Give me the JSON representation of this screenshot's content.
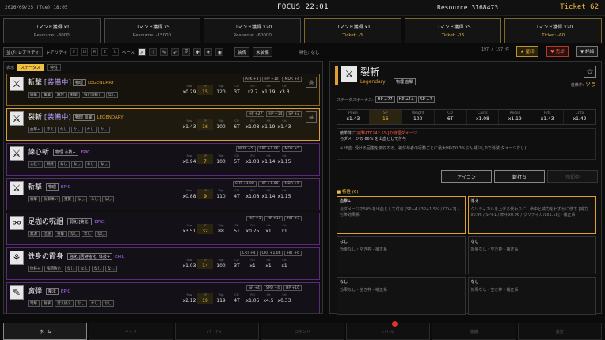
{
  "topbar": {
    "datetime": "2026/09/25 (Tue) 18:05",
    "focus": "FOCUS 22:01",
    "resource": "Resource 3168473",
    "ticket": "Ticket 62"
  },
  "commands": [
    {
      "title": "コマンド獲得 x1",
      "cost": "Resource: -3000"
    },
    {
      "title": "コマンド獲得 x5",
      "cost": "Resource: -15000"
    },
    {
      "title": "コマンド獲得 x20",
      "cost": "Resource: -60000"
    },
    {
      "title": "コマンド獲得 x1",
      "cost": "Ticket: -3"
    },
    {
      "title": "コマンド獲得 x5",
      "cost": "Ticket: -15"
    },
    {
      "title": "コマンド獲得 x20",
      "cost": "Ticket: -60"
    }
  ],
  "filter": {
    "rarity_btn": "並び: レアリティ",
    "rarity_label": "レアリティ",
    "letters": [
      "C",
      "U",
      "R",
      "E",
      "L"
    ],
    "base_label": "ベース",
    "owned": "装備",
    "unequip": "未装備",
    "trait_label": "特性: なし",
    "count": "197 / 197\n件",
    "fav": "★ 星印",
    "kyu": "♥ 売却",
    "sort": "▼ 詳細"
  },
  "list": {
    "show": "表示",
    "tab1": "ステータス",
    "tab2": "特性",
    "items": [
      {
        "name": "斬撃",
        "equip": "[装備中]",
        "tag": "物理",
        "rar": "LEGENDARY",
        "rcls": "legendary",
        "cls": "leg",
        "icon": "⚔",
        "traits": [
          "痛撃",
          "撃撃",
          "麻合",
          "軽量",
          "強い溶斬し",
          "なし"
        ],
        "bonus": [
          "ATK +3",
          "HP +10",
          "MDR +4"
        ],
        "stats": [
          "x0.29",
          "15",
          "120",
          "3T",
          "x2.7",
          "x1.19",
          "x3.3"
        ],
        "mark": "☠"
      },
      {
        "name": "裂斬",
        "equip": "[装備中]",
        "tag": "物理 血擊",
        "rar": "LEGENDARY",
        "rcls": "legendary",
        "cls": "sel",
        "icon": "⚔",
        "traits": [
          "血撃+",
          "浮え",
          "なし",
          "なし",
          "なし",
          "なし"
        ],
        "bonus": [
          "HP +27",
          "HP +14",
          "SP +2"
        ],
        "stats": [
          "x1.43",
          "16",
          "100",
          "6T",
          "x1.08",
          "x1.19",
          "x1.43"
        ],
        "mark": "☠"
      },
      {
        "name": "練心斬",
        "equip": "",
        "tag": "物理 心技+",
        "rar": "EPIC",
        "rcls": "epic",
        "cls": "",
        "icon": "⚔",
        "traits": [
          "心技+",
          "燃焼",
          "なし",
          "なし",
          "なし",
          "なし"
        ],
        "bonus": [
          "MDR +5",
          "CRT +1.06",
          "MDR +5"
        ],
        "stats": [
          "x0.94",
          "7",
          "100",
          "5T",
          "x1.08",
          "x1.14",
          "x1.15"
        ],
        "mark": ""
      },
      {
        "name": "斬撃",
        "equip": "",
        "tag": "物理",
        "rar": "EPIC",
        "rcls": "epic",
        "cls": "",
        "icon": "⚔",
        "traits": [
          "痛撃",
          "攻御陣い",
          "重覧",
          "なし",
          "なし",
          "なし"
        ],
        "bonus": [
          "CRT +1.08",
          "HIT +1.06",
          "MDR +5"
        ],
        "stats": [
          "x0.88",
          "9",
          "110",
          "4T",
          "x1.08",
          "x1.14",
          "x1.15"
        ],
        "mark": ""
      },
      {
        "name": "足枷の呪詛",
        "equip": "",
        "tag": "弱化 [鈍化]",
        "rar": "EPIC",
        "rcls": "epic",
        "cls": "",
        "icon": "⚯",
        "traits": [
          "無源",
          "迅速",
          "重撃",
          "なし",
          "なし",
          "なし"
        ],
        "bonus": [
          "HIT +5",
          "HP +10",
          "HIT +5"
        ],
        "stats": [
          "x3.51",
          "32",
          "88",
          "5T",
          "x0.75",
          "x1",
          "x1"
        ],
        "mark": ""
      },
      {
        "name": "鉄身の霞身",
        "equip": "",
        "tag": "強化 [回避強化] 体技+",
        "rar": "EPIC",
        "rcls": "epic",
        "cls": "",
        "icon": "⚘",
        "traits": [
          "体技+",
          "強靭防い",
          "なし",
          "なし",
          "なし",
          "なし"
        ],
        "bonus": [
          "CRT +4",
          "CRT +1.06",
          "HIT +6"
        ],
        "stats": [
          "x1.03",
          "14",
          "100",
          "3T",
          "x1",
          "x1",
          "x1"
        ],
        "mark": ""
      },
      {
        "name": "魔弾",
        "equip": "",
        "tag": "魔法",
        "rar": "EPIC",
        "rcls": "epic",
        "cls": "",
        "icon": "✎",
        "traits": [
          "電撃",
          "耐撃",
          "溜え続え",
          "なし",
          "なし",
          "なし"
        ],
        "bonus": [
          "SP +4",
          "SPD +4",
          "HP +16"
        ],
        "stats": [
          "x2.12",
          "19",
          "119",
          "4T",
          "x1.05",
          "x4.5",
          "x0.33"
        ],
        "mark": ""
      }
    ],
    "stat_heads": [
      "Pow",
      "SP",
      "Wgt",
      "CD",
      "Rcl",
      "Hit",
      "Crt"
    ]
  },
  "detail": {
    "name": "裂斬",
    "rarity": "Legendary",
    "tag": "物理 血擊",
    "star": "☆",
    "owner_label": "装備中:",
    "owner": "ソラ",
    "bonus_label": "ステータスボーナス:",
    "bonus": [
      "HP +27",
      "HP +14",
      "SP +2"
    ],
    "stats": [
      {
        "h": "Powe",
        "v": "x1.43"
      },
      {
        "h": "SP",
        "v": "16"
      },
      {
        "h": "Weight",
        "v": "100"
      },
      {
        "h": "CD",
        "v": "6T"
      },
      {
        "h": "Casts",
        "v": "x1.08"
      },
      {
        "h": "Recoil",
        "v": "x1.19"
      },
      {
        "h": "Hits",
        "v": "x1.43"
      },
      {
        "h": "Critx",
        "v": "x1.42"
      }
    ],
    "desc1": "敵単体に",
    "desc1b": "[威撃ATK142.5%]の物理ダメージ",
    "desc2": "与ダメージの 66% を出血として付与",
    "note": "※ 出血: 受ける回復を吸収する。被付与者の行動ごとに最大HPの0.3%ぶん減少し0で消滅(ダメージなし)",
    "btn_icon": "アイコン",
    "btn_lock": "鍵打ち",
    "btn_sell": "売却中",
    "trait_head": "■ 特性 (6)",
    "traits": [
      {
        "t": "血撃+",
        "d": "与ダメージの50%を出血として付与 [SP+4 / 3P+1.5% / CD+2] - 付帯効果系",
        "hl": true
      },
      {
        "t": "浮え",
        "d": "クリティカルを上げる代わりに、命中と威力をわずかに低下 [威力x0.96 / SP+1 / 命中x0.96 / クリティカルx1.18] - 補正系",
        "hl": true
      },
      {
        "t": "なし",
        "d": "効果なし・空き枠 - 補正系",
        "hl": false
      },
      {
        "t": "なし",
        "d": "効果なし・空き枠 - 補正系",
        "hl": false
      },
      {
        "t": "なし",
        "d": "効果なし・空き枠 - 補正系",
        "hl": false
      },
      {
        "t": "なし",
        "d": "効果なし・空き枠 - 補正系",
        "hl": false
      }
    ]
  },
  "nav": [
    "ホーム",
    "キャラ",
    "パーティー",
    "コマンド",
    "バトル",
    "装備",
    "設定"
  ]
}
